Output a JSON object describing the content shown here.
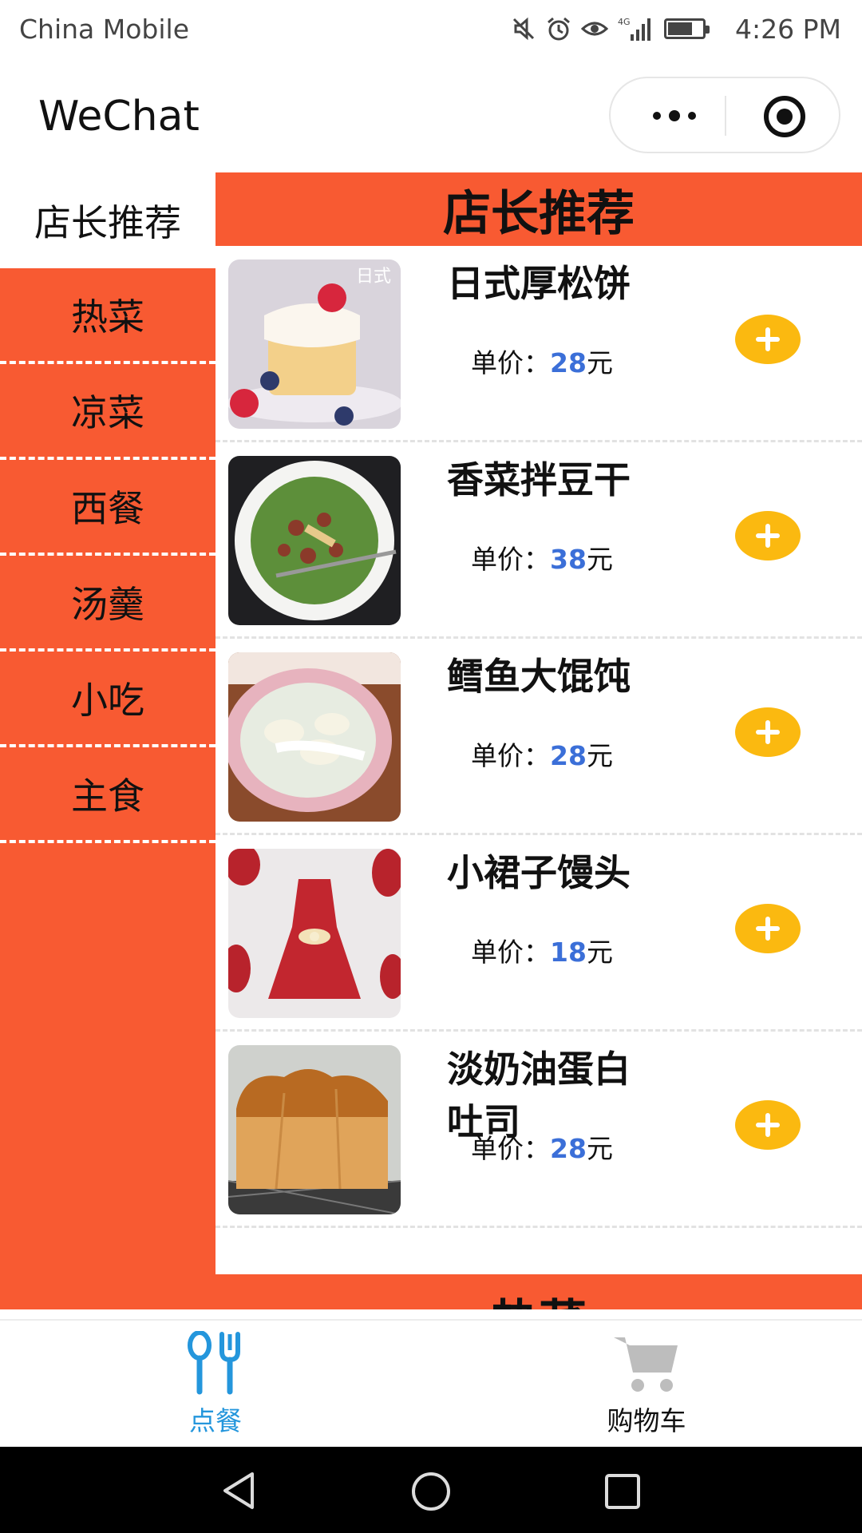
{
  "status_bar": {
    "carrier": "China Mobile",
    "time": "4:26 PM",
    "icons": [
      "mute-icon",
      "alarm-icon",
      "eye-icon",
      "signal-4g-icon",
      "battery-icon"
    ]
  },
  "nav": {
    "title": "WeChat"
  },
  "sidebar": {
    "active": "店长推荐",
    "items": [
      {
        "label": "热菜"
      },
      {
        "label": "凉菜"
      },
      {
        "label": "西餐"
      },
      {
        "label": "汤羹"
      },
      {
        "label": "小吃"
      },
      {
        "label": "主食"
      }
    ]
  },
  "main": {
    "section_title": "店长推荐",
    "next_section_title": "热菜",
    "price_label": "单价：",
    "currency": "元",
    "dishes": [
      {
        "name": "日式厚松饼",
        "price": "28"
      },
      {
        "name": "香菜拌豆干",
        "price": "38"
      },
      {
        "name": "鳕鱼大馄饨",
        "price": "28"
      },
      {
        "name": "小裙子馒头",
        "price": "18"
      },
      {
        "name": "淡奶油蛋白吐司",
        "price": "28"
      }
    ]
  },
  "tabbar": {
    "tabs": [
      {
        "label": "点餐",
        "icon": "utensils-icon",
        "active": true
      },
      {
        "label": "购物车",
        "icon": "cart-icon",
        "active": false
      }
    ]
  },
  "colors": {
    "accent": "#f85a32",
    "price": "#3b6fd8",
    "add_button": "#fbb910",
    "tab_active": "#2496dc"
  }
}
